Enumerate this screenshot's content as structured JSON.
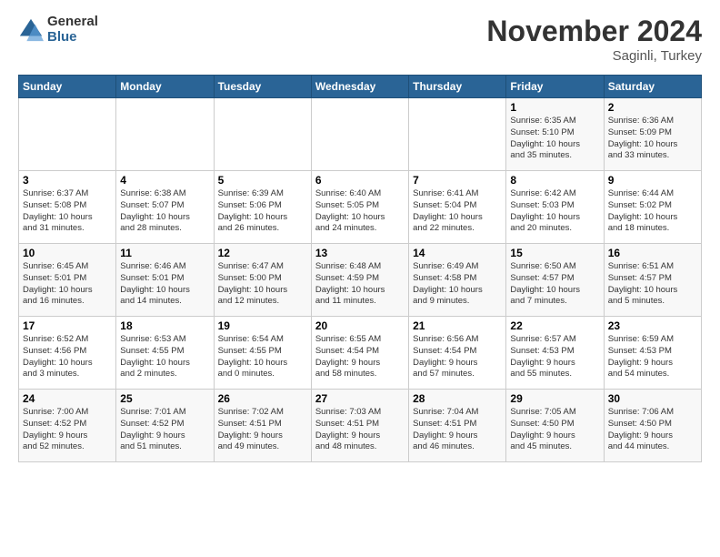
{
  "logo": {
    "general": "General",
    "blue": "Blue"
  },
  "header": {
    "month": "November 2024",
    "location": "Saginli, Turkey"
  },
  "weekdays": [
    "Sunday",
    "Monday",
    "Tuesday",
    "Wednesday",
    "Thursday",
    "Friday",
    "Saturday"
  ],
  "weeks": [
    [
      {
        "day": "",
        "info": ""
      },
      {
        "day": "",
        "info": ""
      },
      {
        "day": "",
        "info": ""
      },
      {
        "day": "",
        "info": ""
      },
      {
        "day": "",
        "info": ""
      },
      {
        "day": "1",
        "info": "Sunrise: 6:35 AM\nSunset: 5:10 PM\nDaylight: 10 hours\nand 35 minutes."
      },
      {
        "day": "2",
        "info": "Sunrise: 6:36 AM\nSunset: 5:09 PM\nDaylight: 10 hours\nand 33 minutes."
      }
    ],
    [
      {
        "day": "3",
        "info": "Sunrise: 6:37 AM\nSunset: 5:08 PM\nDaylight: 10 hours\nand 31 minutes."
      },
      {
        "day": "4",
        "info": "Sunrise: 6:38 AM\nSunset: 5:07 PM\nDaylight: 10 hours\nand 28 minutes."
      },
      {
        "day": "5",
        "info": "Sunrise: 6:39 AM\nSunset: 5:06 PM\nDaylight: 10 hours\nand 26 minutes."
      },
      {
        "day": "6",
        "info": "Sunrise: 6:40 AM\nSunset: 5:05 PM\nDaylight: 10 hours\nand 24 minutes."
      },
      {
        "day": "7",
        "info": "Sunrise: 6:41 AM\nSunset: 5:04 PM\nDaylight: 10 hours\nand 22 minutes."
      },
      {
        "day": "8",
        "info": "Sunrise: 6:42 AM\nSunset: 5:03 PM\nDaylight: 10 hours\nand 20 minutes."
      },
      {
        "day": "9",
        "info": "Sunrise: 6:44 AM\nSunset: 5:02 PM\nDaylight: 10 hours\nand 18 minutes."
      }
    ],
    [
      {
        "day": "10",
        "info": "Sunrise: 6:45 AM\nSunset: 5:01 PM\nDaylight: 10 hours\nand 16 minutes."
      },
      {
        "day": "11",
        "info": "Sunrise: 6:46 AM\nSunset: 5:01 PM\nDaylight: 10 hours\nand 14 minutes."
      },
      {
        "day": "12",
        "info": "Sunrise: 6:47 AM\nSunset: 5:00 PM\nDaylight: 10 hours\nand 12 minutes."
      },
      {
        "day": "13",
        "info": "Sunrise: 6:48 AM\nSunset: 4:59 PM\nDaylight: 10 hours\nand 11 minutes."
      },
      {
        "day": "14",
        "info": "Sunrise: 6:49 AM\nSunset: 4:58 PM\nDaylight: 10 hours\nand 9 minutes."
      },
      {
        "day": "15",
        "info": "Sunrise: 6:50 AM\nSunset: 4:57 PM\nDaylight: 10 hours\nand 7 minutes."
      },
      {
        "day": "16",
        "info": "Sunrise: 6:51 AM\nSunset: 4:57 PM\nDaylight: 10 hours\nand 5 minutes."
      }
    ],
    [
      {
        "day": "17",
        "info": "Sunrise: 6:52 AM\nSunset: 4:56 PM\nDaylight: 10 hours\nand 3 minutes."
      },
      {
        "day": "18",
        "info": "Sunrise: 6:53 AM\nSunset: 4:55 PM\nDaylight: 10 hours\nand 2 minutes."
      },
      {
        "day": "19",
        "info": "Sunrise: 6:54 AM\nSunset: 4:55 PM\nDaylight: 10 hours\nand 0 minutes."
      },
      {
        "day": "20",
        "info": "Sunrise: 6:55 AM\nSunset: 4:54 PM\nDaylight: 9 hours\nand 58 minutes."
      },
      {
        "day": "21",
        "info": "Sunrise: 6:56 AM\nSunset: 4:54 PM\nDaylight: 9 hours\nand 57 minutes."
      },
      {
        "day": "22",
        "info": "Sunrise: 6:57 AM\nSunset: 4:53 PM\nDaylight: 9 hours\nand 55 minutes."
      },
      {
        "day": "23",
        "info": "Sunrise: 6:59 AM\nSunset: 4:53 PM\nDaylight: 9 hours\nand 54 minutes."
      }
    ],
    [
      {
        "day": "24",
        "info": "Sunrise: 7:00 AM\nSunset: 4:52 PM\nDaylight: 9 hours\nand 52 minutes."
      },
      {
        "day": "25",
        "info": "Sunrise: 7:01 AM\nSunset: 4:52 PM\nDaylight: 9 hours\nand 51 minutes."
      },
      {
        "day": "26",
        "info": "Sunrise: 7:02 AM\nSunset: 4:51 PM\nDaylight: 9 hours\nand 49 minutes."
      },
      {
        "day": "27",
        "info": "Sunrise: 7:03 AM\nSunset: 4:51 PM\nDaylight: 9 hours\nand 48 minutes."
      },
      {
        "day": "28",
        "info": "Sunrise: 7:04 AM\nSunset: 4:51 PM\nDaylight: 9 hours\nand 46 minutes."
      },
      {
        "day": "29",
        "info": "Sunrise: 7:05 AM\nSunset: 4:50 PM\nDaylight: 9 hours\nand 45 minutes."
      },
      {
        "day": "30",
        "info": "Sunrise: 7:06 AM\nSunset: 4:50 PM\nDaylight: 9 hours\nand 44 minutes."
      }
    ]
  ]
}
